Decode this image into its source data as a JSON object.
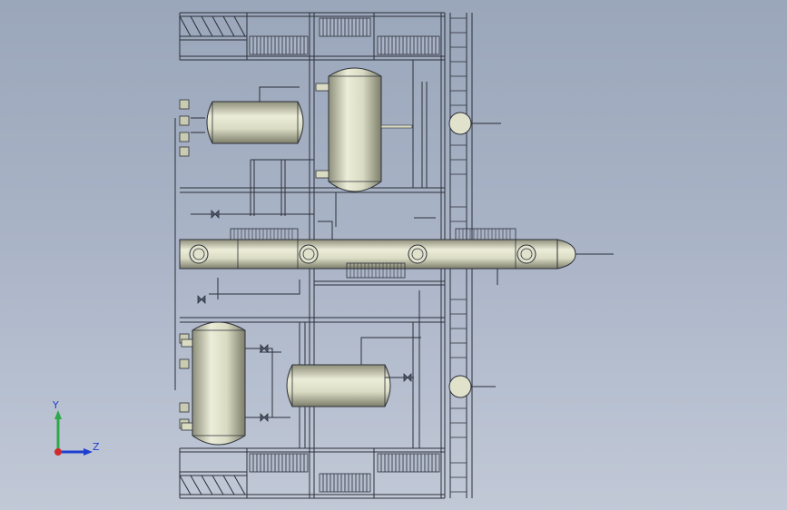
{
  "viewport": {
    "background_top": "#9aa6ba",
    "background_bottom": "#c1c9d7",
    "line_color": "#2b2f38",
    "vessel_color": "#c9cbb2"
  },
  "triad": {
    "y_label": "Y",
    "z_label": "Z",
    "y_axis_color": "#2fa84a",
    "z_axis_color": "#1f3fd0",
    "x_axis_color": "#d12a2a"
  }
}
